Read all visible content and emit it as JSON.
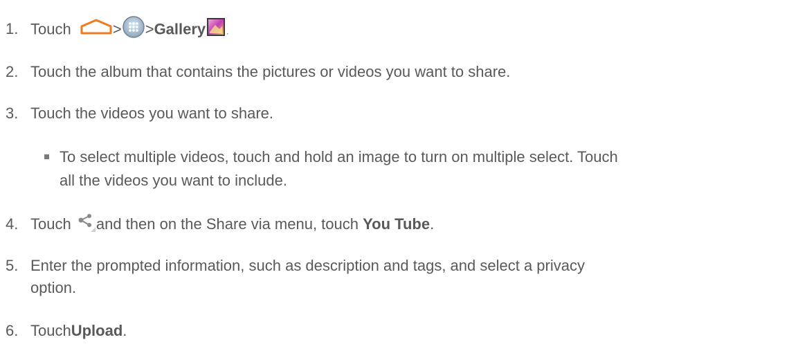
{
  "steps": [
    {
      "num": "1.",
      "pre": "Touch",
      "sep1": ">",
      "sep2": ">",
      "bold": "Gallery",
      "post": "."
    },
    {
      "num": "2.",
      "text": "Touch the album that contains the pictures or videos you want to share."
    },
    {
      "num": "3.",
      "text": "Touch the videos you want to share."
    },
    {
      "num": "4.",
      "pre": "Touch",
      "mid": "and then on the Share via menu, touch",
      "bold": "You Tube",
      "post": "."
    },
    {
      "num": "5.",
      "line1": "Enter the prompted information, such as description and tags, and select a privacy",
      "line2": "option."
    },
    {
      "num": "6.",
      "pre": "Touch",
      "bold": "Upload",
      "post": "."
    }
  ],
  "bullet": {
    "line1": "To select multiple videos, touch and hold an image to turn on multiple select. Touch",
    "line2": "all the videos you want to include."
  },
  "icons": {
    "home": "home-icon",
    "apps": "apps-icon",
    "gallery": "gallery-icon",
    "share": "share-icon"
  },
  "colors": {
    "text": "#595959",
    "home_orange": "#f07b1d"
  }
}
